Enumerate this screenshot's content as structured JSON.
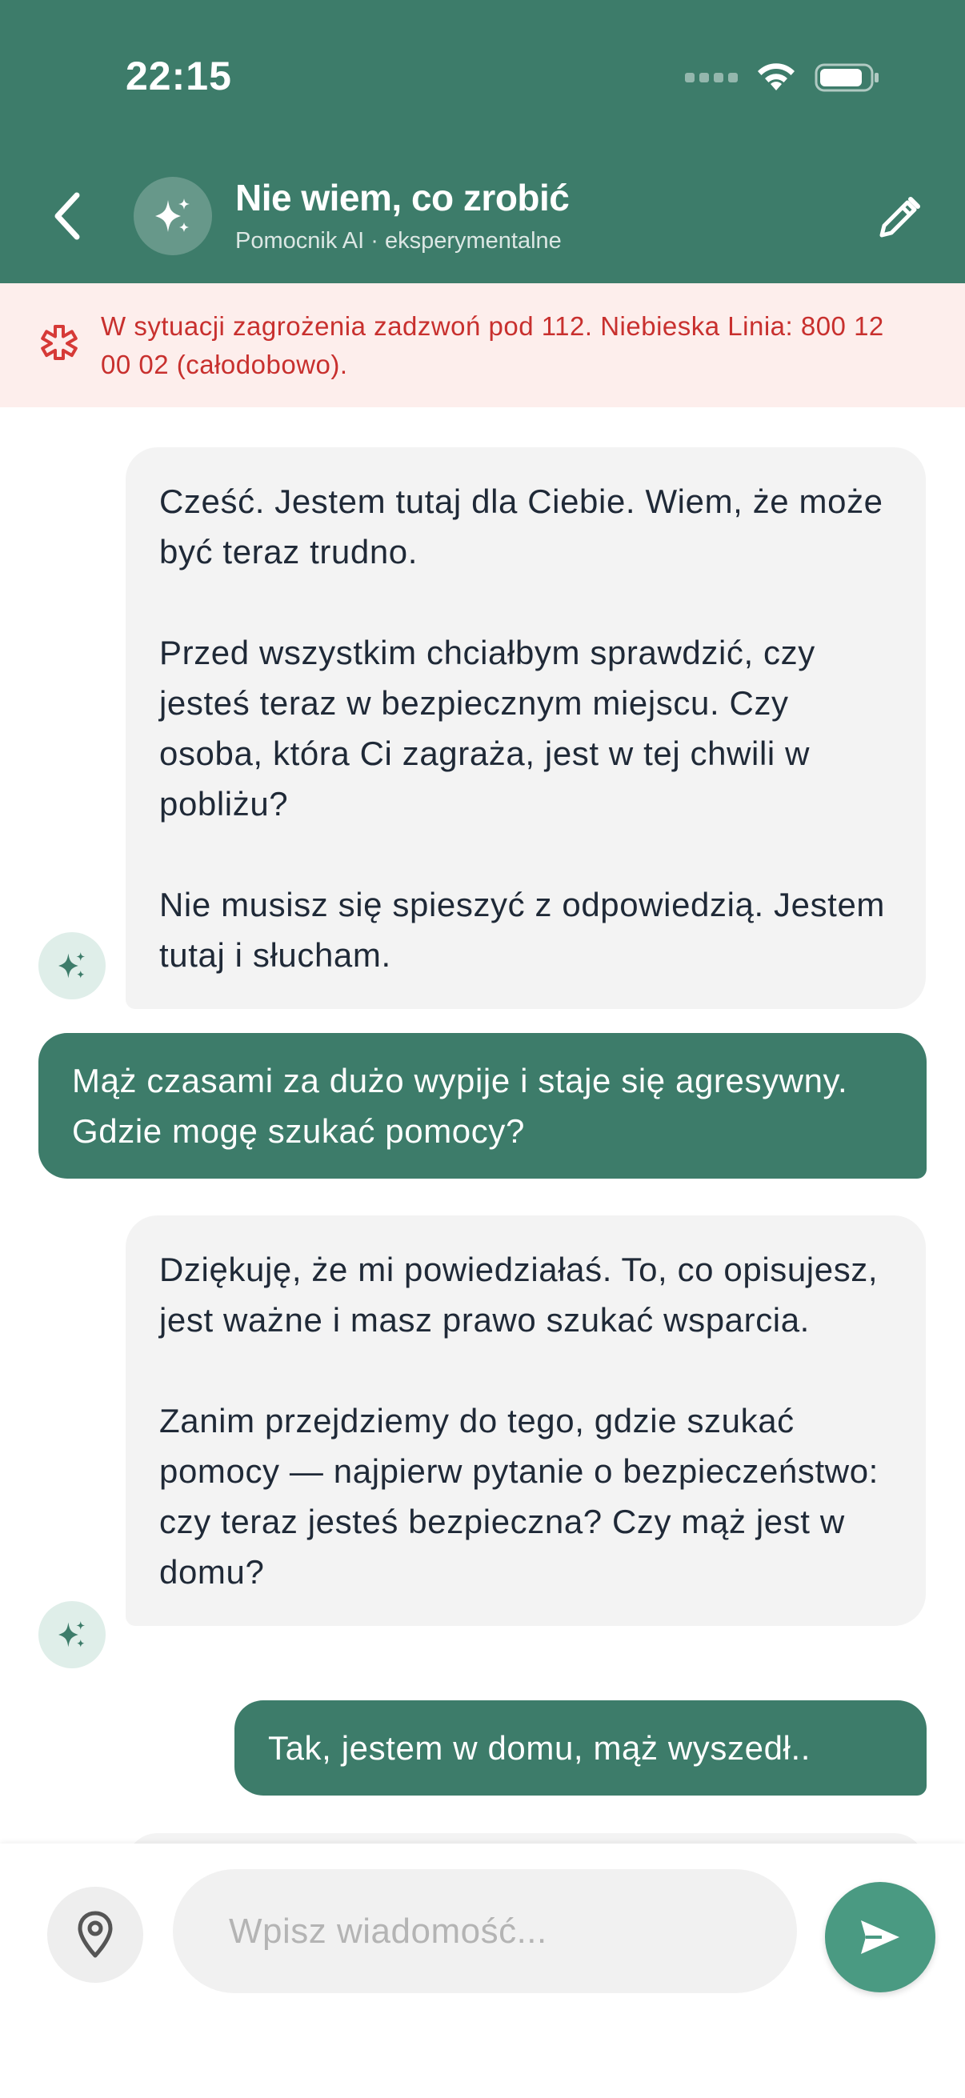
{
  "status_bar": {
    "time": "22:15"
  },
  "header": {
    "title": "Nie wiem, co zrobić",
    "subtitle": "Pomocnik AI · eksperymentalne",
    "accent_color": "#3d7c6a"
  },
  "alert": {
    "icon": "medical-asterisk-icon",
    "text": "W sytuacji zagrożenia zadzwoń pod 112. Niebieska Linia: 800 12 00 02 (całodobowo).",
    "color": "#c8302e",
    "background": "#fdeeec"
  },
  "messages": [
    {
      "role": "ai",
      "paragraphs": [
        "Cześć. Jestem tutaj dla Ciebie. Wiem, że może być teraz trudno.",
        "Przed wszystkim chciałbym sprawdzić, czy jesteś teraz w bezpiecznym miejscu. Czy osoba, która Ci zagraża, jest w tej chwili w pobliżu?",
        "Nie musisz się spieszyć z odpowiedzią. Jestem tutaj i słucham."
      ]
    },
    {
      "role": "user",
      "text": "Mąż czasami za dużo wypije i staje się agresywny. Gdzie mogę szukać pomocy?"
    },
    {
      "role": "ai",
      "paragraphs": [
        "Dziękuję, że mi powiedziałaś. To, co opisujesz, jest ważne i masz prawo szukać wsparcia.",
        "Zanim przejdziemy do tego, gdzie szukać pomocy — najpierw pytanie o bezpieczeństwo: czy teraz jesteś bezpieczna? Czy mąż jest w domu?"
      ]
    },
    {
      "role": "user",
      "text": "Tak, jestem w domu, mąż wyszedł.."
    }
  ],
  "composer": {
    "placeholder": "Wpisz wiadomość...",
    "value": ""
  }
}
